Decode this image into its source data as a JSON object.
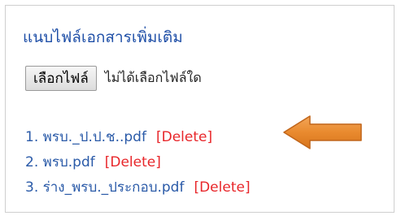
{
  "panel": {
    "title": "แนบไฟล์เอกสารเพิ่มเติม"
  },
  "file_input": {
    "button_label": "เลือกไฟล์",
    "status_text": "ไม่ได้เลือกไฟล์ใด"
  },
  "files": [
    {
      "name": "1. พรบ._ป.ป.ช..pdf",
      "delete_label": "[Delete]"
    },
    {
      "name": "2. พรบ.pdf",
      "delete_label": "[Delete]"
    },
    {
      "name": "3. ร่าง_พรบ._ประกอบ.pdf",
      "delete_label": "[Delete]"
    }
  ],
  "colors": {
    "title": "#1f4fa7",
    "link": "#2a5aa8",
    "delete": "#e8262a",
    "arrow_fill": "#e98a2e",
    "arrow_stroke": "#c0651a"
  },
  "icons": {
    "arrow": "left-arrow-icon"
  }
}
